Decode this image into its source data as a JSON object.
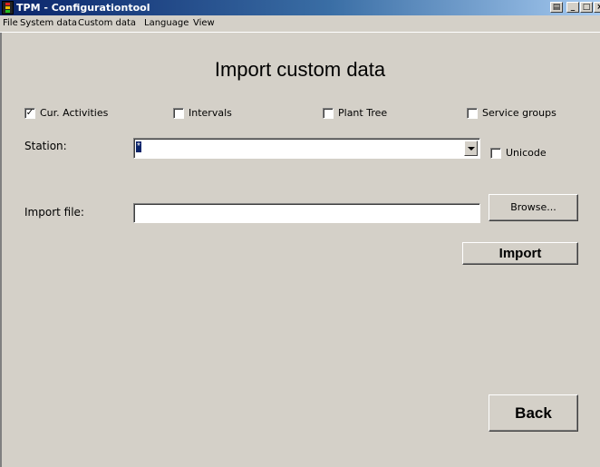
{
  "window": {
    "title": "TPM - Configurationtool",
    "controls": {
      "print": "▤",
      "minimize": "_",
      "maximize": "□",
      "close": "×"
    }
  },
  "menu": [
    "File",
    "System data",
    "Custom data",
    "Language",
    "View"
  ],
  "page": {
    "title": "Import custom data"
  },
  "options": {
    "cur_activities": {
      "label": "Cur. Activities",
      "checked": true,
      "mark": "✓"
    },
    "intervals": {
      "label": "Intervals",
      "checked": false
    },
    "plant_tree": {
      "label": "Plant Tree",
      "checked": false
    },
    "service_groups": {
      "label": "Service groups",
      "checked": false
    }
  },
  "station": {
    "label": "Station:",
    "value": "*"
  },
  "unicode": {
    "label": "Unicode",
    "checked": false
  },
  "import_file": {
    "label": "Import file:",
    "value": ""
  },
  "buttons": {
    "browse": "Browse...",
    "import": "Import",
    "back": "Back"
  }
}
